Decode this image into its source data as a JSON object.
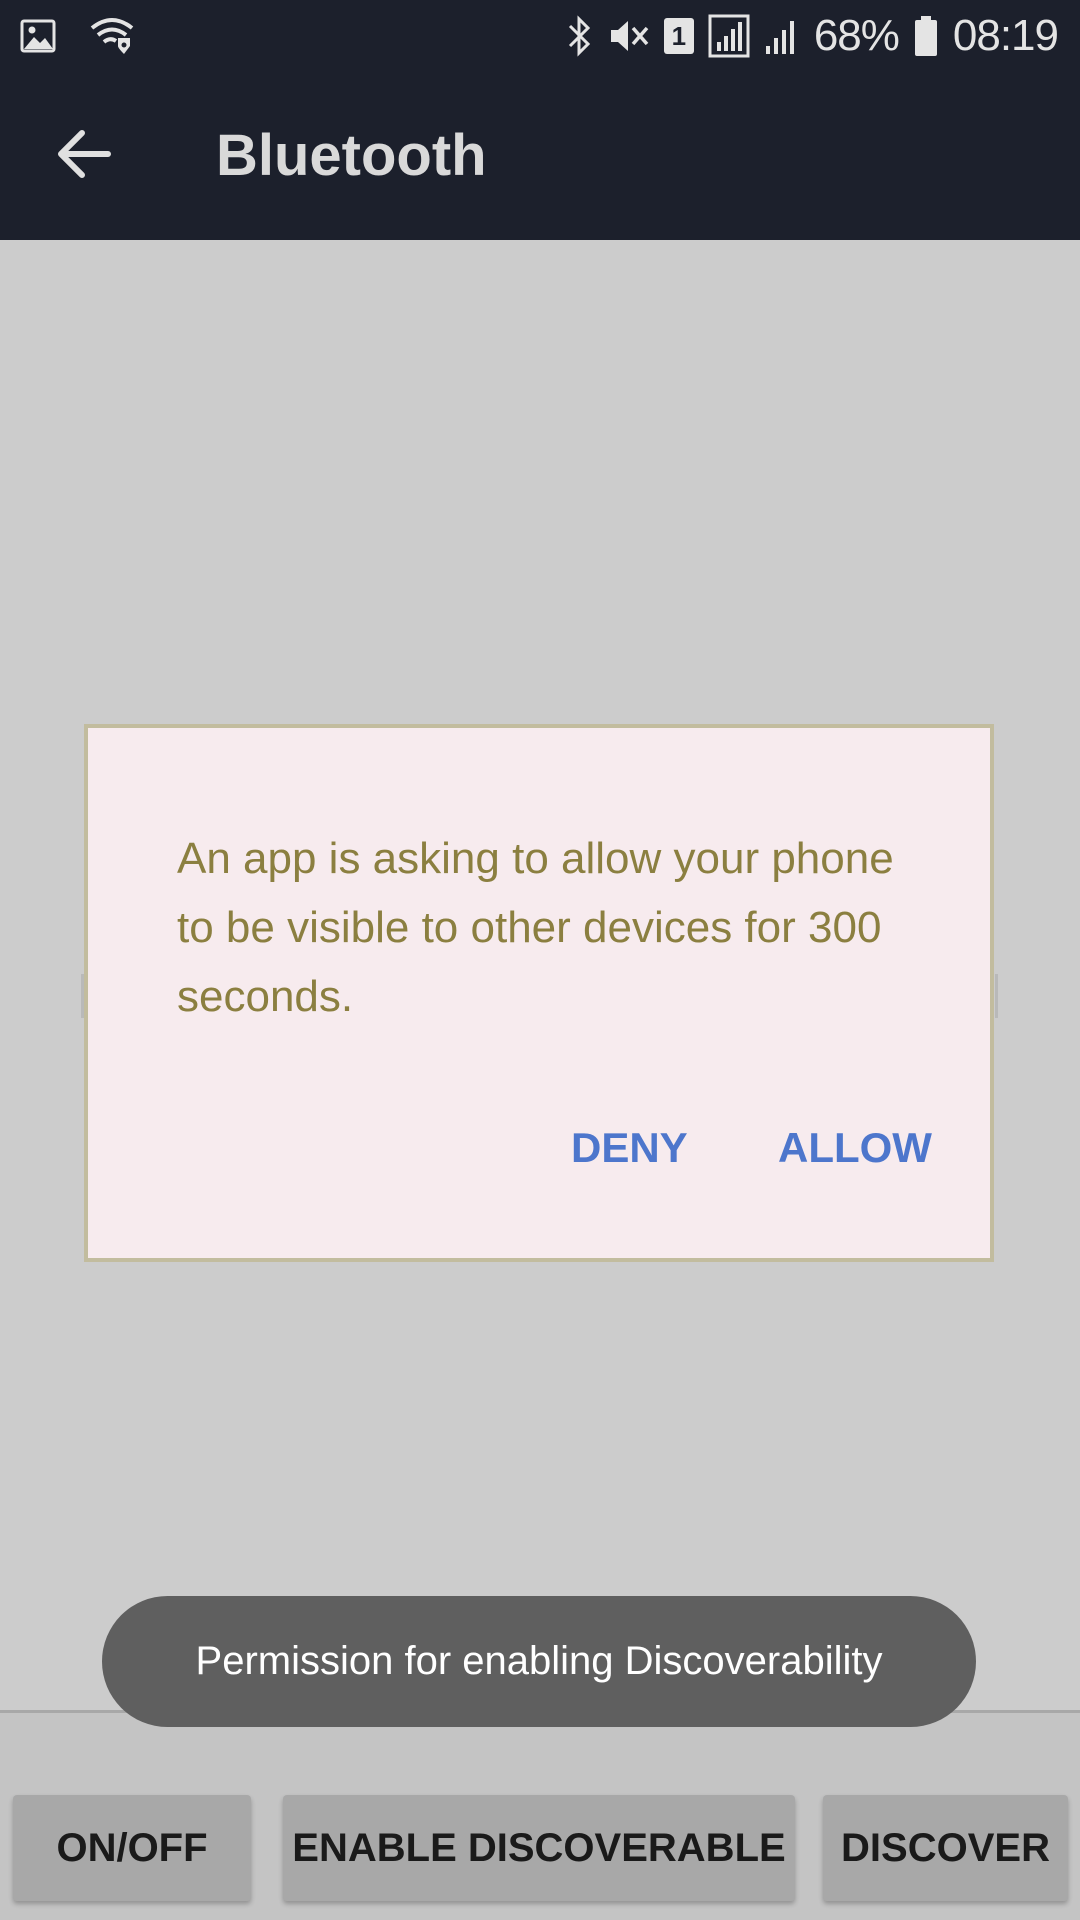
{
  "status_bar": {
    "left_icons": [
      "image-icon",
      "wifi-icon"
    ],
    "right_icons": [
      "bluetooth-icon",
      "mute-icon",
      "sim1-icon",
      "signal-icon",
      "signal-icon"
    ],
    "sim_label": "1",
    "battery": "68%",
    "time": "08:19"
  },
  "app_bar": {
    "back_icon": "arrow-left-icon",
    "title": "Bluetooth"
  },
  "dialog": {
    "message": "An app is asking to allow your phone to be visible to other devices for 300 seconds.",
    "deny_label": "DENY",
    "allow_label": "ALLOW"
  },
  "toast": {
    "text": "Permission for enabling Discoverability"
  },
  "bottom_buttons": {
    "onoff_label": "ON/OFF",
    "discoverable_label": "ENABLE DISCOVERABLE",
    "discover_label": "DISCOVER"
  },
  "colors": {
    "app_bar": "#1c202c",
    "dialog_bg": "#f7ebee",
    "dialog_text": "#8b7f40",
    "dialog_button": "#4d76cc",
    "toast_bg": "#5f5f5f"
  }
}
